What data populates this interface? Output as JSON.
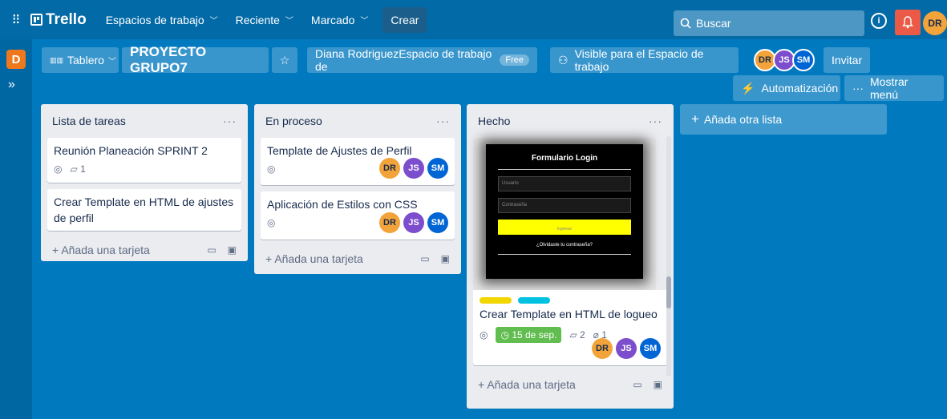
{
  "topbar": {
    "logo": "Trello",
    "menus": [
      "Espacios de trabajo",
      "Reciente",
      "Marcado"
    ],
    "create": "Crear",
    "search_placeholder": "Buscar",
    "user_initials": "DR"
  },
  "rail": {
    "workspace_initial": "D"
  },
  "board": {
    "view": "Tablero",
    "title": "PROYECTO GRUPO7",
    "workspace": "Diana RodriguezEspacio de trabajo de",
    "plan": "Free",
    "visibility": "Visible para el Espacio de trabajo",
    "members": [
      "DR",
      "JS",
      "SM"
    ],
    "invite": "Invitar",
    "automation": "Automatización",
    "show_menu": "Mostrar menú"
  },
  "lists": [
    {
      "title": "Lista de tareas",
      "cards": [
        {
          "title": "Reunión Planeación SPRINT 2",
          "comments": "1"
        },
        {
          "title": "Crear Template en HTML de ajustes de perfil"
        }
      ],
      "add_card": "Añada una tarjeta"
    },
    {
      "title": "En proceso",
      "cards": [
        {
          "title": "Template de Ajustes de Perfil",
          "members": [
            "DR",
            "JS",
            "SM"
          ]
        },
        {
          "title": "Aplicación de Estilos con CSS",
          "members": [
            "DR",
            "JS",
            "SM"
          ]
        }
      ],
      "add_card": "Añada una tarjeta"
    },
    {
      "title": "Hecho",
      "cards": [
        {
          "title": "Crear Template en HTML de logueo",
          "due": "15 de sep.",
          "comments": "2",
          "attachments": "1",
          "members": [
            "DR",
            "JS",
            "SM"
          ],
          "cover": {
            "heading": "Formulario Login",
            "user_field": "Usuario",
            "password_field": "Contraseña",
            "button": "Ingresar",
            "forgot": "¿Olvidaste tu contraseña?"
          },
          "label_colors": [
            "#f2d600",
            "#00c2e0"
          ]
        }
      ],
      "add_card": "Añada una tarjeta"
    }
  ],
  "add_list": "Añada otra lista"
}
